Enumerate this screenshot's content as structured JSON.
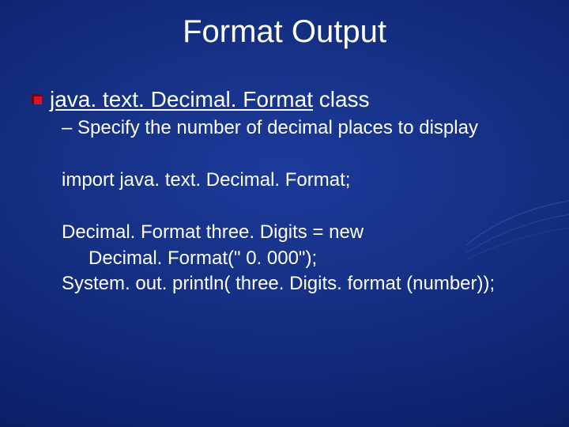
{
  "title": "Format Output",
  "bullet": {
    "class_label_prefix": "java. text. Decimal. Format",
    "class_label_suffix": " class"
  },
  "subpoint": "– Specify the number of decimal places to display",
  "code": {
    "line1": "import java. text. Decimal. Format;",
    "line2a": "Decimal. Format three. Digits = new",
    "line2b": "Decimal. Format(\" 0. 000\");",
    "line3": "System. out. println( three. Digits. format (number));"
  }
}
